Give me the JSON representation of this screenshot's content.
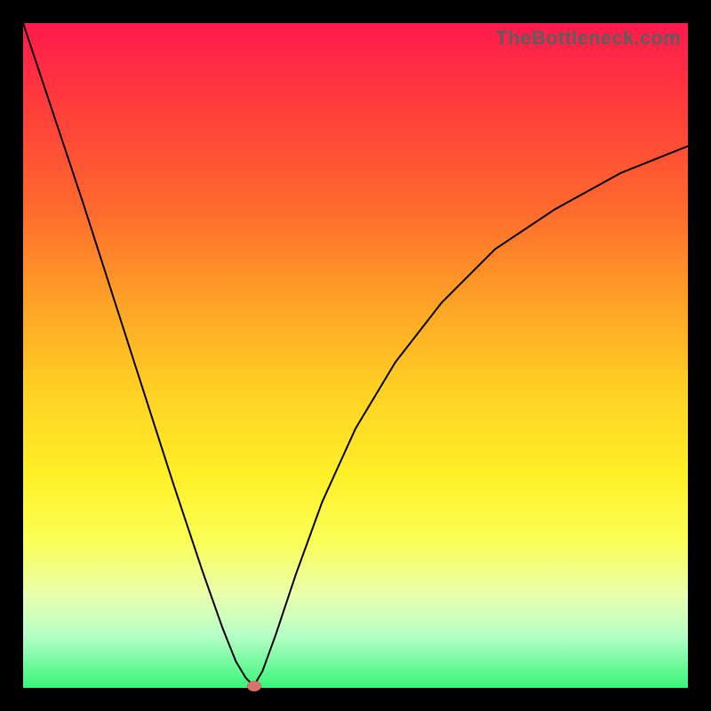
{
  "watermark": "TheBottleneck.com",
  "colors": {
    "frame": "#000000",
    "curve": "#000000",
    "marker": "#d9736a"
  },
  "chart_data": {
    "type": "line",
    "title": "",
    "xlabel": "",
    "ylabel": "",
    "xlim": [
      0,
      100
    ],
    "ylim": [
      0,
      100
    ],
    "grid": false,
    "legend": false,
    "series": [
      {
        "name": "left-branch",
        "x": [
          0.0,
          4.5,
          9.0,
          13.5,
          18.0,
          22.5,
          27.0,
          30.0,
          32.0,
          33.5,
          34.7
        ],
        "values": [
          100.0,
          86.5,
          73.0,
          59.0,
          45.0,
          31.0,
          17.5,
          9.0,
          4.0,
          1.5,
          0.3
        ]
      },
      {
        "name": "right-branch",
        "x": [
          34.7,
          36.0,
          38.0,
          41.0,
          45.0,
          50.0,
          56.0,
          63.0,
          71.0,
          80.0,
          90.0,
          100.0
        ],
        "values": [
          0.3,
          2.5,
          8.0,
          17.0,
          28.0,
          39.0,
          49.0,
          58.0,
          66.0,
          72.0,
          77.5,
          81.5
        ]
      }
    ],
    "marker": {
      "x": 34.7,
      "y": 0.3,
      "label": ""
    },
    "gradient_stops": [
      {
        "pos": 0,
        "color": "#ff1a4d"
      },
      {
        "pos": 12,
        "color": "#ff3b3b"
      },
      {
        "pos": 28,
        "color": "#ff6a2e"
      },
      {
        "pos": 42,
        "color": "#ffa226"
      },
      {
        "pos": 55,
        "color": "#ffd024"
      },
      {
        "pos": 68,
        "color": "#fff028"
      },
      {
        "pos": 78,
        "color": "#fbff57"
      },
      {
        "pos": 86,
        "color": "#e8ffae"
      },
      {
        "pos": 92,
        "color": "#b8ffc8"
      },
      {
        "pos": 100,
        "color": "#38f57a"
      }
    ]
  }
}
